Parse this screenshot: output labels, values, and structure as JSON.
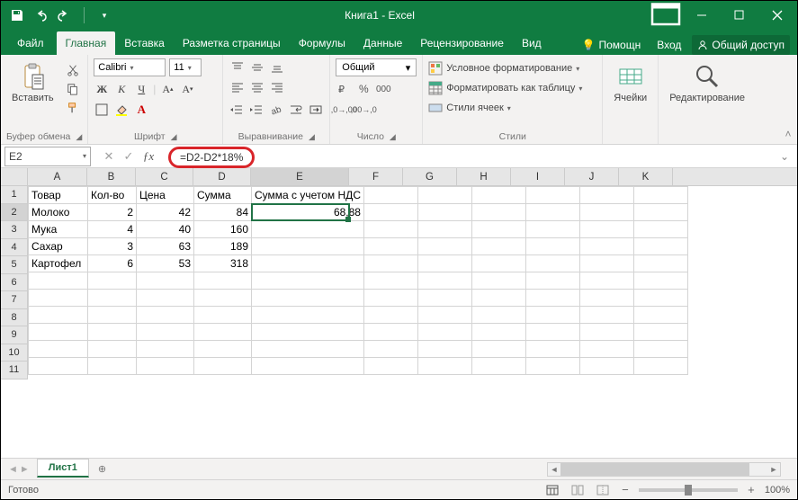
{
  "app_title": "Книга1 - Excel",
  "tabs": {
    "file": "Файл",
    "home": "Главная",
    "insert": "Вставка",
    "layout": "Разметка страницы",
    "formulas": "Формулы",
    "data": "Данные",
    "review": "Рецензирование",
    "view": "Вид"
  },
  "help": {
    "tell_me": "Помощн",
    "signin": "Вход",
    "share": "Общий доступ"
  },
  "ribbon": {
    "clipboard": {
      "paste": "Вставить",
      "label": "Буфер обмена"
    },
    "font": {
      "name": "Calibri",
      "size": "11",
      "label": "Шрифт"
    },
    "align": {
      "label": "Выравнивание"
    },
    "number": {
      "format": "Общий",
      "label": "Число"
    },
    "styles": {
      "cond": "Условное форматирование",
      "table": "Форматировать как таблицу",
      "cell": "Стили ячеек",
      "label": "Стили"
    },
    "cells": {
      "btn": "Ячейки"
    },
    "editing": {
      "btn": "Редактирование"
    }
  },
  "namebox": "E2",
  "formula": "=D2-D2*18%",
  "columns": [
    "A",
    "B",
    "C",
    "D",
    "E",
    "F",
    "G",
    "H",
    "I",
    "J",
    "K"
  ],
  "sheet": {
    "headers": [
      "Товар",
      "Кол-во",
      "Цена",
      "Сумма",
      "Сумма с учетом НДС"
    ],
    "rows": [
      {
        "a": "Молоко",
        "b": "2",
        "c": "42",
        "d": "84",
        "e": "68,88"
      },
      {
        "a": "Мука",
        "b": "4",
        "c": "40",
        "d": "160",
        "e": ""
      },
      {
        "a": "Сахар",
        "b": "3",
        "c": "63",
        "d": "189",
        "e": ""
      },
      {
        "a": "Картофел",
        "b": "6",
        "c": "53",
        "d": "318",
        "e": ""
      }
    ]
  },
  "sheet_tab": "Лист1",
  "status": "Готово",
  "zoom": "100%"
}
